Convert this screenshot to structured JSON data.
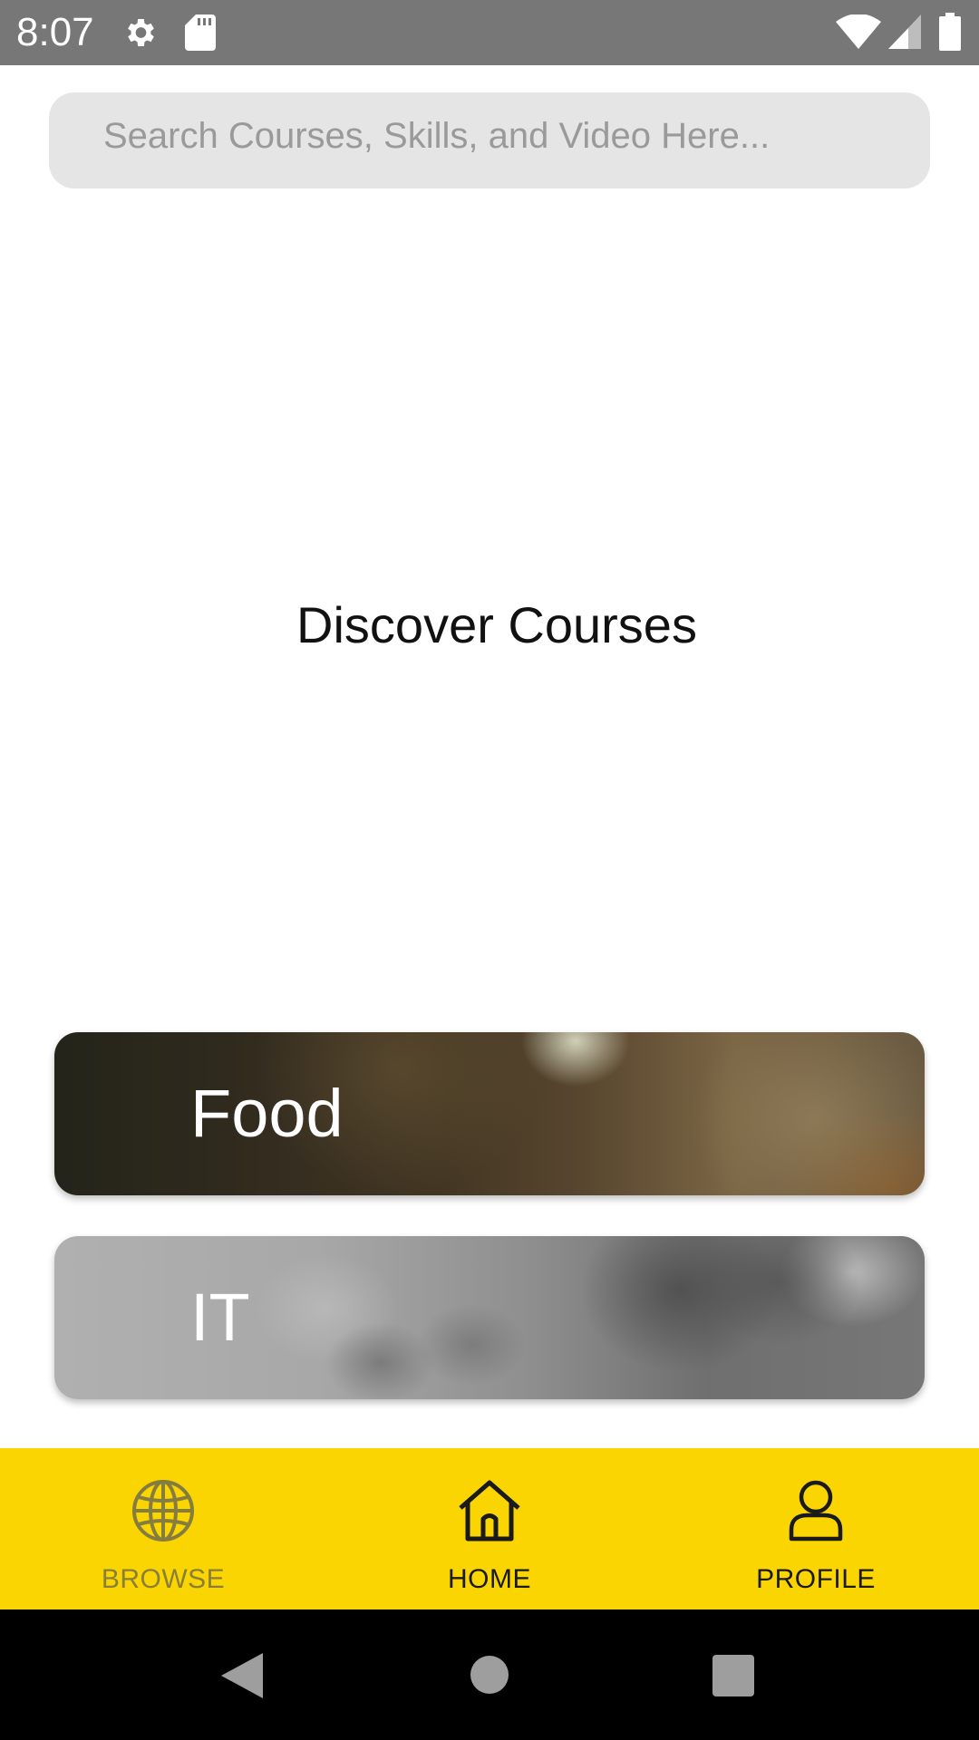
{
  "status_bar": {
    "time": "8:07",
    "background": "#777777",
    "icons": [
      "settings-gear-icon",
      "sd-card-icon",
      "wifi-icon",
      "signal-icon",
      "battery-icon"
    ]
  },
  "search": {
    "placeholder": "Search Courses, Skills, and Video Here..."
  },
  "main": {
    "title": "Discover Courses",
    "categories": [
      {
        "label": "Food"
      },
      {
        "label": "IT"
      }
    ]
  },
  "bottom_nav": {
    "background": "#fad501",
    "items": [
      {
        "label": "BROWSE",
        "icon": "globe-icon",
        "active": false,
        "color": "#8a7f3a"
      },
      {
        "label": "HOME",
        "icon": "home-icon",
        "active": true,
        "color": "#1a1a1a"
      },
      {
        "label": "PROFILE",
        "icon": "person-icon",
        "active": true,
        "color": "#1a1a1a"
      }
    ]
  },
  "system_nav": {
    "buttons": [
      "back-icon",
      "home-circle-icon",
      "recents-square-icon"
    ]
  }
}
